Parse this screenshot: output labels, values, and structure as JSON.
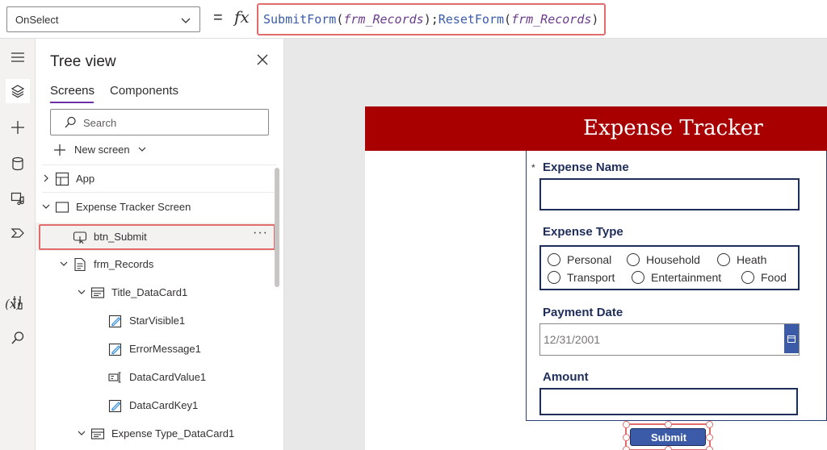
{
  "formula_bar": {
    "property": "OnSelect",
    "equals": "=",
    "fx": "fx",
    "formula": {
      "fn1": "SubmitForm",
      "arg1": "frm_Records",
      "sep": ");",
      "fn2": "ResetForm",
      "arg2": "frm_Records",
      "open": "(",
      "close": ")"
    }
  },
  "rail": {
    "items": [
      "hamburger-icon",
      "layers-icon",
      "plus-icon",
      "database-icon",
      "media-icon",
      "power-automate-icon",
      "variables-icon",
      "tools-icon",
      "search-icon"
    ],
    "variables_label": "(x)"
  },
  "tree": {
    "title": "Tree view",
    "tabs": [
      "Screens",
      "Components"
    ],
    "search_placeholder": "Search",
    "new_screen": "New screen",
    "items": [
      {
        "label": "App"
      },
      {
        "label": "Expense Tracker Screen"
      },
      {
        "label": "btn_Submit"
      },
      {
        "label": "frm_Records"
      },
      {
        "label": "Title_DataCard1"
      },
      {
        "label": "StarVisible1"
      },
      {
        "label": "ErrorMessage1"
      },
      {
        "label": "DataCardValue1"
      },
      {
        "label": "DataCardKey1"
      },
      {
        "label": "Expense Type_DataCard1"
      }
    ],
    "more": "···"
  },
  "app": {
    "title": "Expense Tracker",
    "star": "*",
    "fields": {
      "expense_name": "Expense Name",
      "expense_type": "Expense Type",
      "payment_date": "Payment Date",
      "amount": "Amount"
    },
    "radio_options": [
      "Personal",
      "Household",
      "Heath",
      "Transport",
      "Entertainment",
      "Food"
    ],
    "date_value": "12/31/2001",
    "submit": "Submit"
  },
  "colors": {
    "header": "#a80000",
    "accent": "#3b5ba9",
    "highlight": "#e06c6c"
  }
}
